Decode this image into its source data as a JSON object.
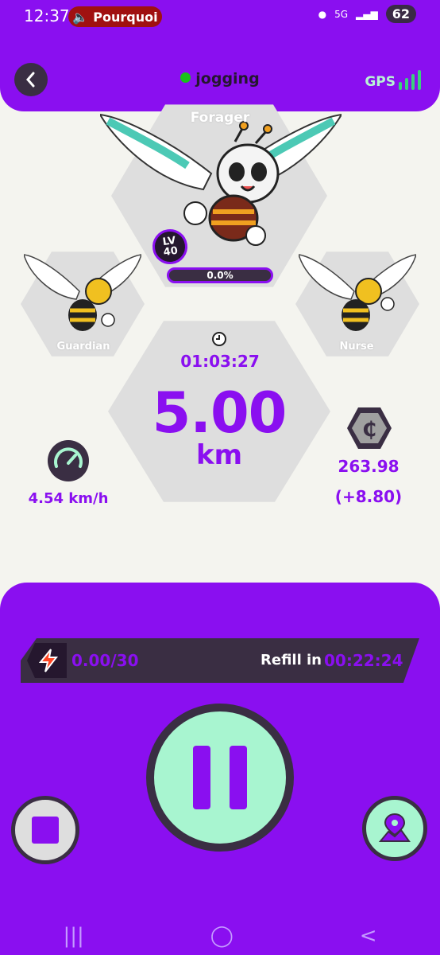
{
  "status_bar": {
    "time": "12:37",
    "media_label": "Pourquoi",
    "network": "5G",
    "battery": "62"
  },
  "header": {
    "activity": "jogging",
    "gps_label": "GPS"
  },
  "bees": {
    "forager": {
      "name": "Forager",
      "level_prefix": "LV",
      "level": "40",
      "progress_text": "0.0%",
      "progress": 0.0
    },
    "guardian": {
      "name": "Guardian"
    },
    "nurse": {
      "name": "Nurse"
    }
  },
  "stats": {
    "time": "01:03:27",
    "distance": "5.00",
    "distance_unit": "km",
    "speed": "4.54 km/h",
    "balance": "263.98",
    "gain": "(+8.80)"
  },
  "energy": {
    "value": "0.00/30",
    "refill_label": "Refill in",
    "refill_time": "00:22:24"
  },
  "colors": {
    "accent": "#8a0ff0",
    "dark": "#3a2e43",
    "mint": "#a8f5d0",
    "gps_green": "#3ad17d"
  },
  "icons": {
    "back": "chevron-left-icon",
    "clock": "clock-icon",
    "speed": "speedometer-icon",
    "coin": "coin-icon",
    "energy": "lightning-icon",
    "pause": "pause-icon",
    "stop": "stop-icon",
    "map": "map-pin-icon"
  }
}
